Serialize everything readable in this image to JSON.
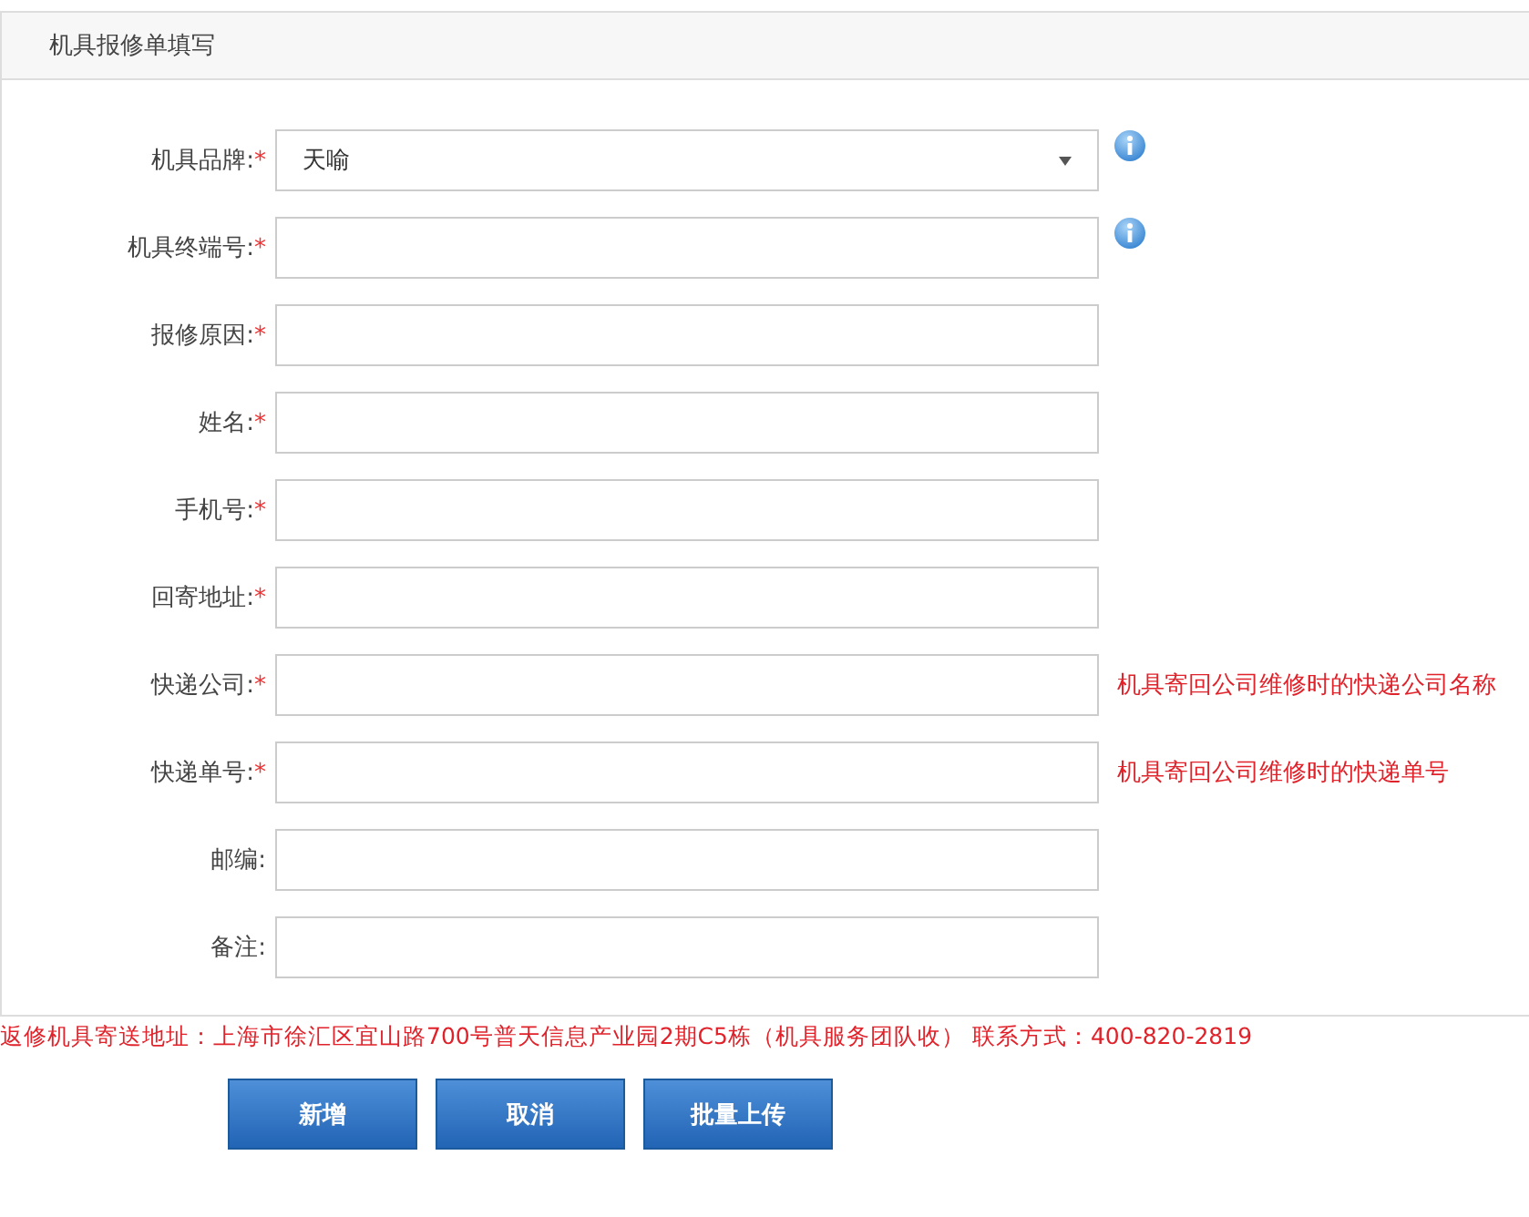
{
  "panel": {
    "title": "机具报修单填写"
  },
  "fields": [
    {
      "kind": "select",
      "label": "机具品牌:",
      "required_mark": "*",
      "value": "天喻",
      "info": true
    },
    {
      "kind": "text",
      "label": "机具终端号:",
      "required_mark": "*",
      "info": true
    },
    {
      "kind": "text",
      "label": "报修原因:",
      "required_mark": "*",
      "info": false
    },
    {
      "kind": "text",
      "label": "姓名:",
      "required_mark": "*",
      "info": false
    },
    {
      "kind": "text",
      "label": "手机号:",
      "required_mark": "*",
      "info": false
    },
    {
      "kind": "text",
      "label": "回寄地址:",
      "required_mark": "*",
      "info": false
    },
    {
      "kind": "text",
      "label": "快递公司:",
      "required_mark": "*",
      "info": false,
      "hint": "机具寄回公司维修时的快递公司名称"
    },
    {
      "kind": "text",
      "label": "快递单号:",
      "required_mark": "*",
      "info": false,
      "hint": "机具寄回公司维修时的快递单号"
    },
    {
      "kind": "text",
      "label": "邮编:",
      "info": false
    },
    {
      "kind": "text",
      "label": "备注:",
      "info": false
    }
  ],
  "notice": "返修机具寄送地址：上海市徐汇区宜山路700号普天信息产业园2期C5栋（机具服务团队收） 联系方式：400-820-2819",
  "buttons": [
    "新增",
    "取消",
    "批量上传"
  ]
}
